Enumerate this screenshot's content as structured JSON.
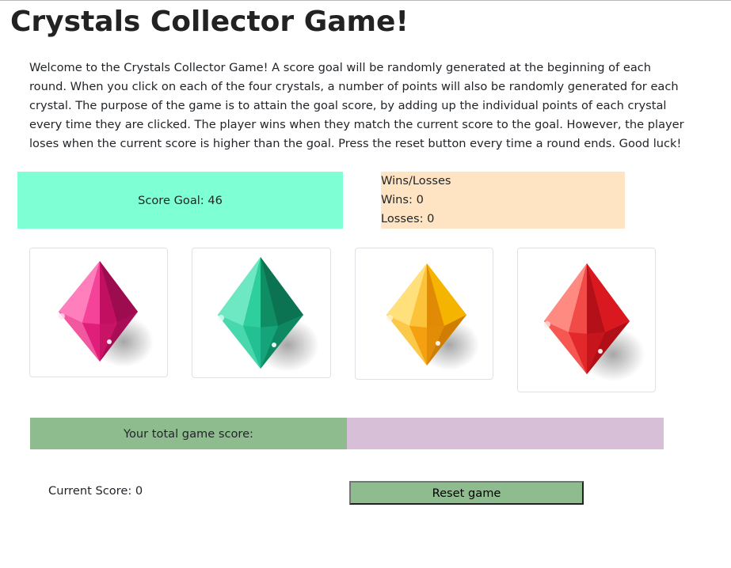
{
  "page": {
    "title": "Crystals Collector Game!",
    "instructions": "Welcome to the Crystals Collector Game! A score goal will be randomly generated at the beginning of each round. When you click on each of the four crystals, a number of points will also be randomly generated for each crystal. The purpose of the game is to attain the goal score, by adding up the individual points of each crystal every time they are clicked. The player wins when they match the current score to the goal. However, the player loses when the current score is higher than the goal. Press the reset button every time a round ends. Good luck!"
  },
  "score_goal": {
    "text": "Score Goal: 46",
    "value": 46,
    "background": "#7fffd4"
  },
  "record": {
    "heading": "Wins/Losses",
    "wins_text": "Wins: 0",
    "losses_text": "Losses: 0",
    "wins": 0,
    "losses": 0,
    "background": "#ffe4c4"
  },
  "crystals": [
    {
      "name": "pink-crystal",
      "color": "#e8157a"
    },
    {
      "name": "green-crystal",
      "color": "#1fb98a"
    },
    {
      "name": "yellow-crystal",
      "color": "#f7a70c"
    },
    {
      "name": "red-crystal",
      "color": "#e8262a"
    }
  ],
  "total_score": {
    "label": "Your total game score:",
    "left_background": "#8fbc8f",
    "right_background": "#d8bfd8"
  },
  "current_score": {
    "text": "Current Score: 0",
    "value": 0
  },
  "reset": {
    "label": "Reset game",
    "background": "#8fbc8f"
  }
}
